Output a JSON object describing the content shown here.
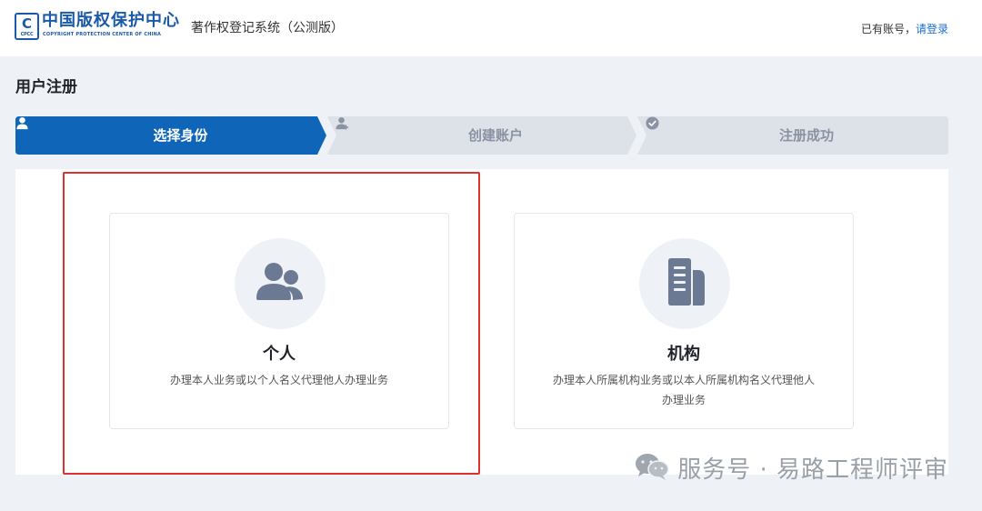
{
  "header": {
    "logo_mark": "C",
    "logo_mark_sub": "CPCC",
    "logo_cn": "中国版权保护中心",
    "logo_en": "COPYRIGHT PROTECTION CENTER OF CHINA",
    "system_title": "著作权登记系统（公测版）",
    "login_prompt": "已有账号，",
    "login_link": "请登录"
  },
  "page": {
    "title": "用户注册"
  },
  "steps": [
    {
      "label": "选择身份",
      "icon": "user-icon",
      "state": "active"
    },
    {
      "label": "创建账户",
      "icon": "user-add-icon",
      "state": "inactive"
    },
    {
      "label": "注册成功",
      "icon": "check-circle-icon",
      "state": "inactive"
    }
  ],
  "cards": {
    "personal": {
      "title": "个人",
      "description": "办理本人业务或以个人名义代理他人办理业务",
      "icon": "people-icon"
    },
    "organization": {
      "title": "机构",
      "description": "办理本人所属机构业务或以本人所属机构名义代理他人办理业务",
      "icon": "building-icon"
    }
  },
  "colors": {
    "accent": "#1a6fd1",
    "step_active": "#0f66b8",
    "step_inactive": "#dde2e8",
    "highlight": "#e03131"
  },
  "watermark": {
    "text": "服务号 · 易路工程师评审"
  }
}
